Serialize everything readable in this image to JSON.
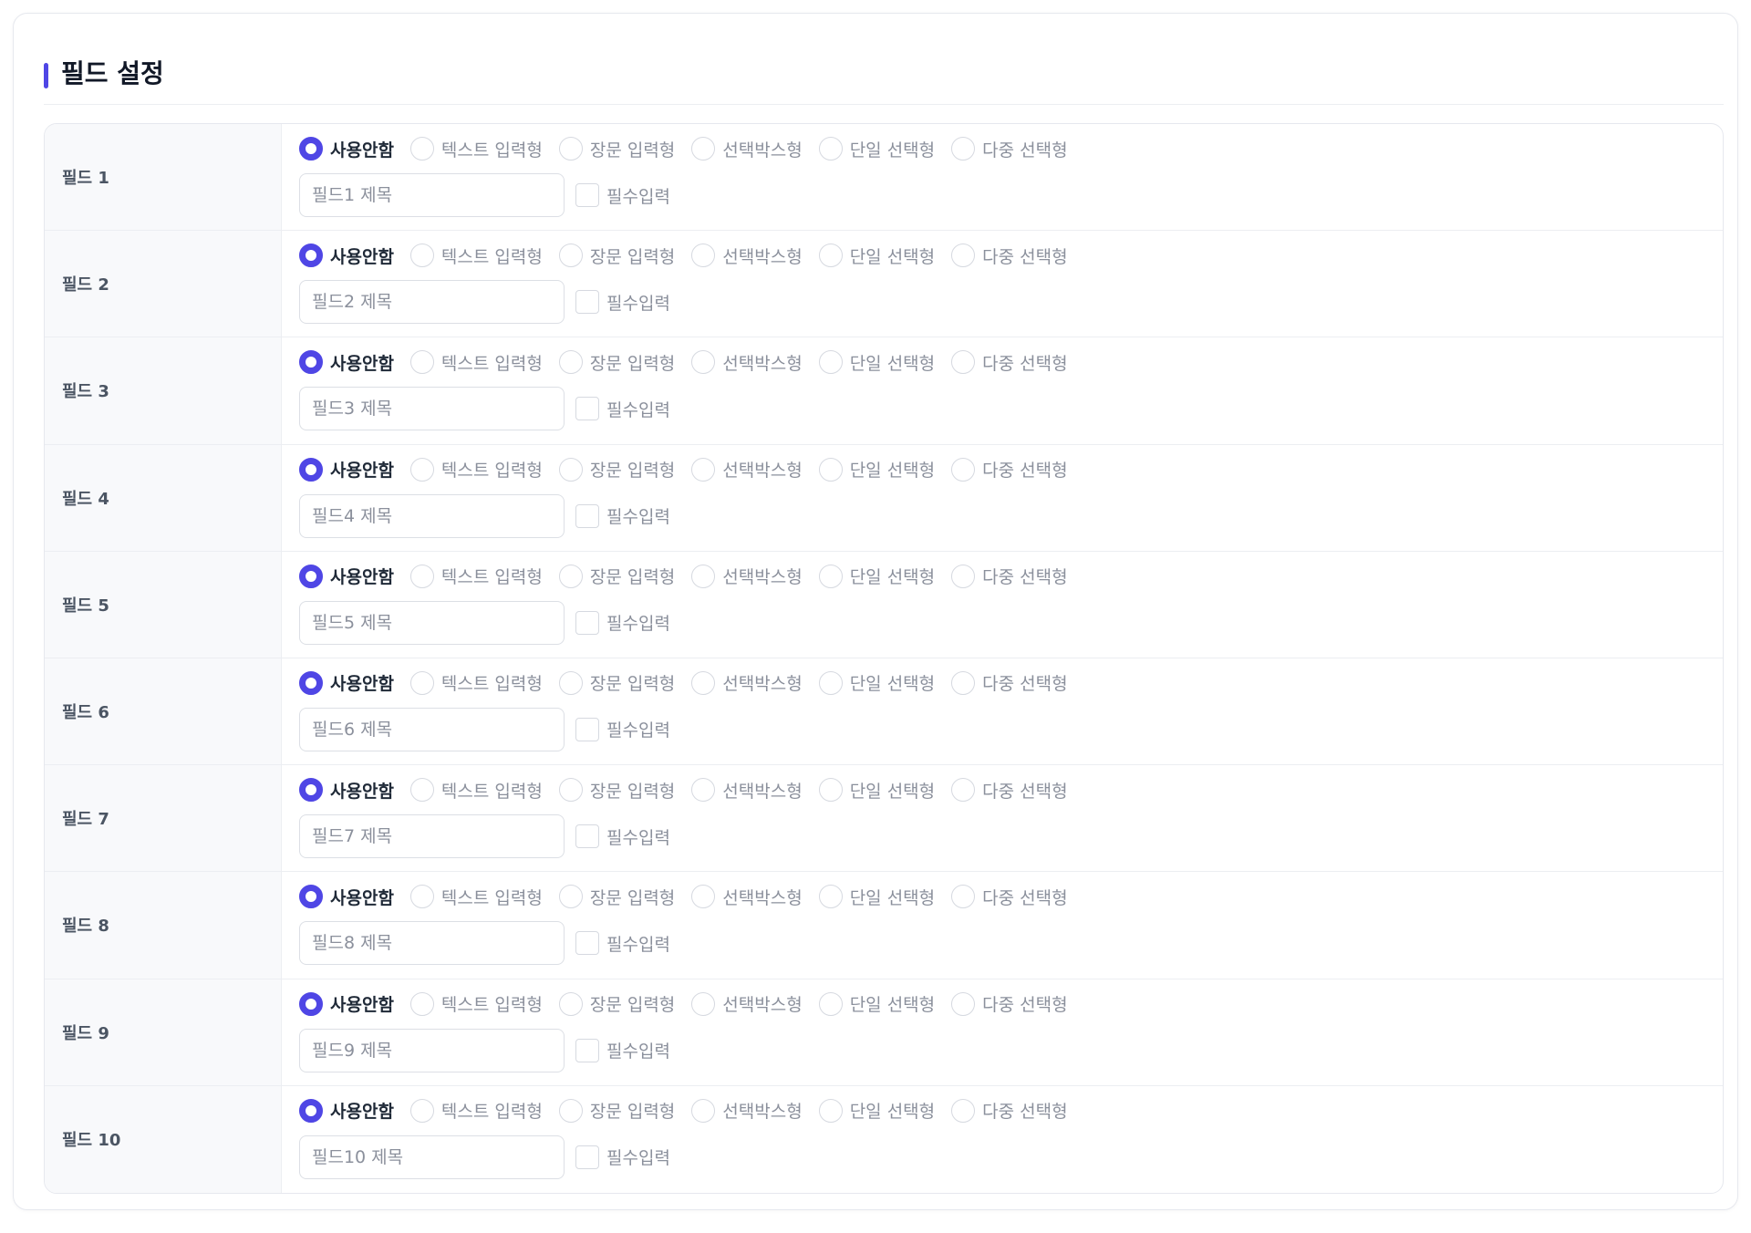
{
  "section": {
    "title": "필드 설정"
  },
  "colors": {
    "accent": "#4f46e5",
    "border": "#e6e8ee",
    "label_bg": "#f8f9fb"
  },
  "type_options": [
    "사용안함",
    "텍스트 입력형",
    "장문 입력형",
    "선택박스형",
    "단일 선택형",
    "다중 선택형"
  ],
  "required_label": "필수입력",
  "fields": [
    {
      "label": "필드 1",
      "selected": 0,
      "title_value": "",
      "title_placeholder": "필드1 제목",
      "required": false
    },
    {
      "label": "필드 2",
      "selected": 0,
      "title_value": "",
      "title_placeholder": "필드2 제목",
      "required": false
    },
    {
      "label": "필드 3",
      "selected": 0,
      "title_value": "",
      "title_placeholder": "필드3 제목",
      "required": false
    },
    {
      "label": "필드 4",
      "selected": 0,
      "title_value": "",
      "title_placeholder": "필드4 제목",
      "required": false
    },
    {
      "label": "필드 5",
      "selected": 0,
      "title_value": "",
      "title_placeholder": "필드5 제목",
      "required": false
    },
    {
      "label": "필드 6",
      "selected": 0,
      "title_value": "",
      "title_placeholder": "필드6 제목",
      "required": false
    },
    {
      "label": "필드 7",
      "selected": 0,
      "title_value": "",
      "title_placeholder": "필드7 제목",
      "required": false
    },
    {
      "label": "필드 8",
      "selected": 0,
      "title_value": "",
      "title_placeholder": "필드8 제목",
      "required": false
    },
    {
      "label": "필드 9",
      "selected": 0,
      "title_value": "",
      "title_placeholder": "필드9 제목",
      "required": false
    },
    {
      "label": "필드 10",
      "selected": 0,
      "title_value": "",
      "title_placeholder": "필드10 제목",
      "required": false
    }
  ]
}
